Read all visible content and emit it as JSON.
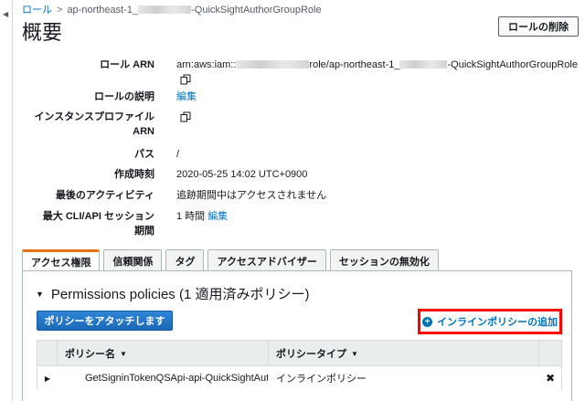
{
  "breadcrumb": {
    "root": "ロール",
    "separator": ">",
    "current_prefix": "ap-northeast-1_",
    "current_suffix": "-QuickSightAuthorGroupRole"
  },
  "page": {
    "title": "概要",
    "delete_button": "ロールの削除"
  },
  "summary": {
    "role_arn": {
      "label": "ロール ARN",
      "value_prefix": "arn:aws:iam::",
      "value_middle": "role/ap-northeast-1_",
      "value_suffix": "-QuickSightAuthorGroupRole"
    },
    "description": {
      "label": "ロールの説明",
      "edit": "編集"
    },
    "instance_profile_arn": {
      "label_line1": "インスタンスプロファイル",
      "label_line2": "ARN"
    },
    "path": {
      "label": "パス",
      "value": "/"
    },
    "created": {
      "label": "作成時刻",
      "value": "2020-05-25 14:02 UTC+0900"
    },
    "last_activity": {
      "label": "最後のアクティビティ",
      "value": "追跡期間中はアクセスされません"
    },
    "max_session": {
      "label_line1": "最大 CLI/API セッション",
      "label_line2": "期間",
      "value": "1 時間",
      "edit": "編集"
    }
  },
  "tabs": [
    {
      "label": "アクセス権限",
      "active": true
    },
    {
      "label": "信頼関係",
      "active": false
    },
    {
      "label": "タグ",
      "active": false
    },
    {
      "label": "アクセスアドバイザー",
      "active": false
    },
    {
      "label": "セッションの無効化",
      "active": false
    }
  ],
  "permissions": {
    "heading": "Permissions policies (1 適用済みポリシー)",
    "attach_button": "ポリシーをアタッチします",
    "inline_button": "インラインポリシーの追加",
    "columns": [
      "ポリシー名",
      "ポリシータイプ"
    ],
    "rows": [
      {
        "name": "GetSigninTokenQSApi-api-QuickSightAut",
        "type": "インラインポリシー"
      }
    ]
  },
  "colors": {
    "link": "#0073bb",
    "primary_button": "#1b72c4",
    "active_tab_accent": "#ec7211",
    "highlight_box": "#ff0000"
  }
}
